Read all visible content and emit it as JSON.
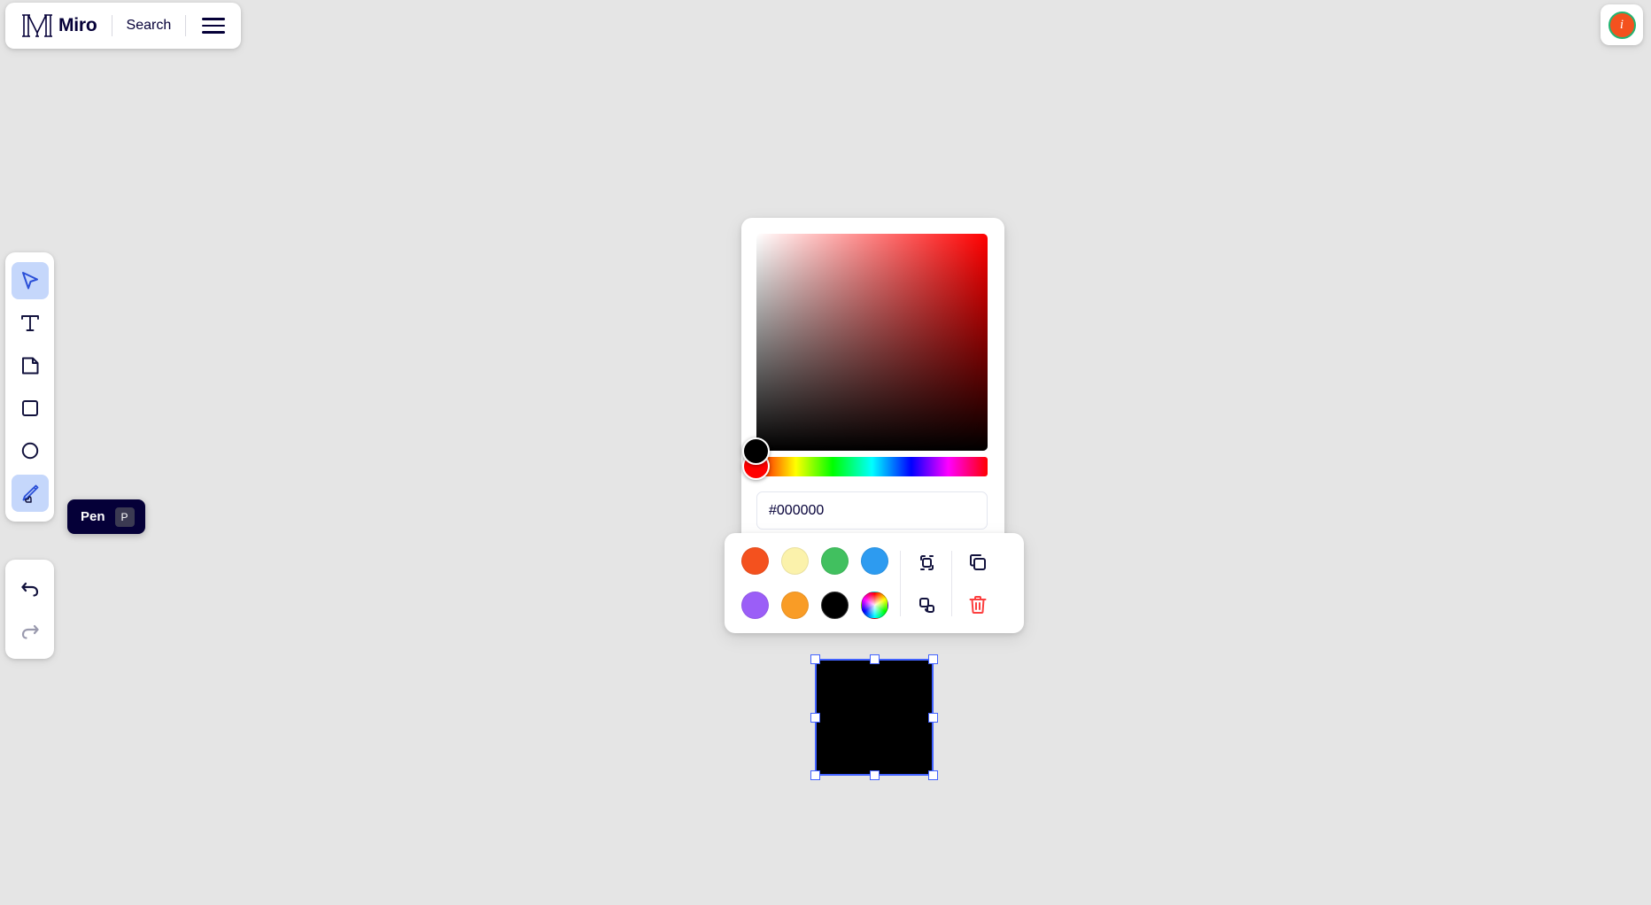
{
  "app": {
    "canvas_background": "#e5e5e5",
    "accent": "#4262ff"
  },
  "top_bar": {
    "logo_icon": "miro-m-logo-icon",
    "brand": "Miro",
    "search_label": "Search",
    "menu_icon": "hamburger-menu-icon"
  },
  "info_button": {
    "icon": "info-icon",
    "glyph": "i",
    "fill": "#f4511e",
    "ring": "#21b573"
  },
  "toolbar": {
    "tools": [
      {
        "name": "select",
        "icon": "cursor-arrow-icon",
        "active": true
      },
      {
        "name": "text",
        "icon": "text-t-icon",
        "active": false
      },
      {
        "name": "sticky-note",
        "icon": "sticky-note-icon",
        "active": false
      },
      {
        "name": "square",
        "icon": "square-shape-icon",
        "active": false
      },
      {
        "name": "circle",
        "icon": "circle-shape-icon",
        "active": false
      },
      {
        "name": "pen",
        "icon": "pen-icon",
        "active": true
      }
    ],
    "undo": {
      "icon": "undo-arrow-icon",
      "enabled": true
    },
    "redo": {
      "icon": "redo-arrow-icon",
      "enabled": false
    }
  },
  "tooltip": {
    "label": "Pen",
    "shortcut": "P"
  },
  "color_picker": {
    "hex_value": "#000000",
    "hex_placeholder": "#000000",
    "hue_degrees": 0,
    "saturation": 0,
    "value": 0,
    "sv_handle_color": "#000000",
    "hue_handle_color": "#ff0000"
  },
  "style_bar": {
    "swatches": [
      {
        "name": "red",
        "color": "#f4511e",
        "selected": false
      },
      {
        "name": "yellow",
        "color": "#fbf2ab",
        "selected": false
      },
      {
        "name": "green",
        "color": "#41c05f",
        "selected": false
      },
      {
        "name": "blue",
        "color": "#2d9bf0",
        "selected": false
      },
      {
        "name": "purple",
        "color": "#9b5ef7",
        "selected": false
      },
      {
        "name": "orange",
        "color": "#f99c26",
        "selected": false
      },
      {
        "name": "black",
        "color": "#000000",
        "selected": true
      },
      {
        "name": "custom-color-wheel",
        "color": "rainbow",
        "selected": false
      }
    ],
    "actions": [
      {
        "name": "bring-to-front",
        "icon": "bring-to-front-icon",
        "color": "#12123d"
      },
      {
        "name": "send-to-back",
        "icon": "send-to-back-icon",
        "color": "#12123d"
      },
      {
        "name": "duplicate",
        "icon": "duplicate-icon",
        "color": "#12123d"
      },
      {
        "name": "delete",
        "icon": "trash-icon",
        "color": "#fc3f3f"
      }
    ]
  },
  "canvas": {
    "shape": {
      "name": "rectangle",
      "fill": "#000000",
      "selected": true,
      "handle_count": 8
    }
  }
}
